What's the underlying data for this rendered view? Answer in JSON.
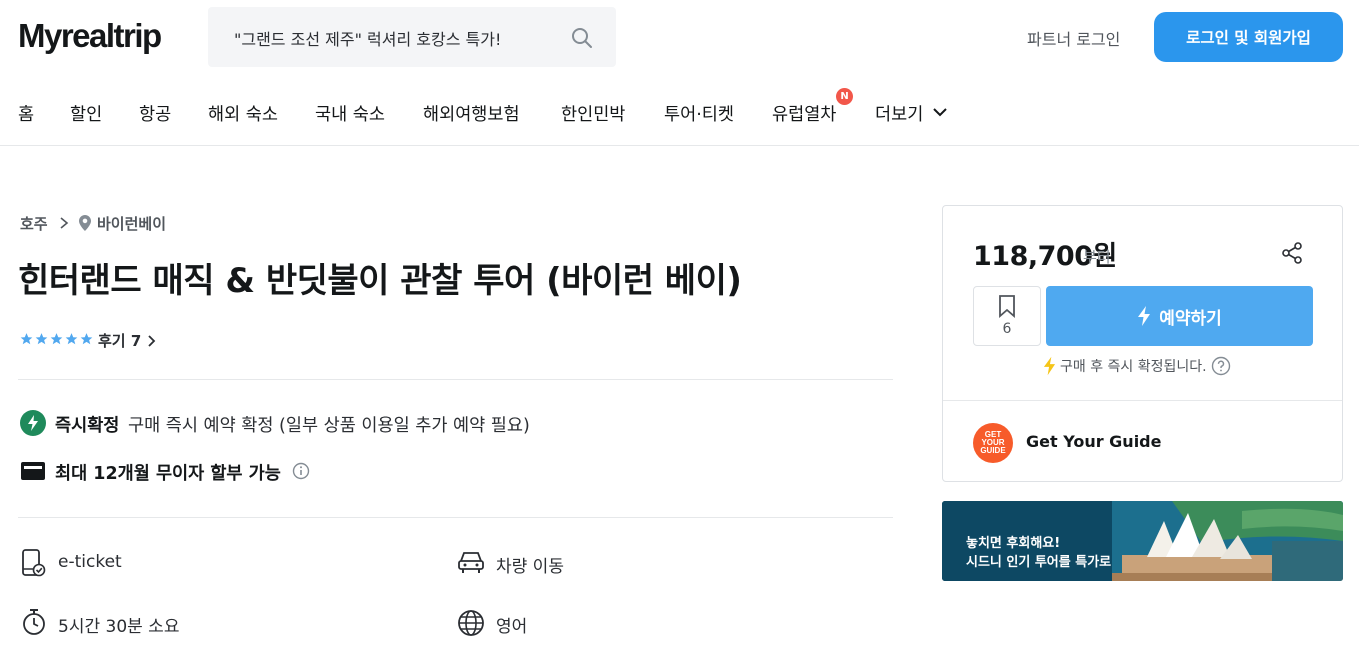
{
  "header": {
    "logo": "Myrealtrip",
    "search_placeholder": "\"그랜드 조선 제주\" 럭셔리 호캉스 특가!",
    "partner_login": "파트너 로그인",
    "login_signup": "로그인 및 회원가입"
  },
  "nav": {
    "items": [
      "홈",
      "할인",
      "항공",
      "해외 숙소",
      "국내 숙소",
      "해외여행보험",
      "한인민박",
      "투어·티켓",
      "유럽열차",
      "더보기"
    ],
    "new_badge": "N"
  },
  "product": {
    "breadcrumb_country": "호주",
    "breadcrumb_city": "바이런베이",
    "title": "힌터랜드 매직 & 반딧불이 관찰 투어 (바이런 베이)",
    "rating": 5,
    "review_label": "후기 7",
    "instant_strong": "즉시확정",
    "instant_text": "구매 즉시 예약 확정 (일부 상품 이용일 추가 예약 필요)",
    "installment": "최대 12개월 무이자 할부 가능",
    "features": {
      "ticket": "e-ticket",
      "transport": "차량 이동",
      "duration": "5시간 30분 소요",
      "language": "영어"
    }
  },
  "sidebar": {
    "price": "118,700원",
    "price_suffix": "부터",
    "wishlist_count": "6",
    "book_button": "예약하기",
    "confirm_text": "구매 후 즉시 확정됩니다.",
    "partner_name": "Get Your Guide",
    "partner_logo_text": "GET YOUR GUIDE"
  },
  "banner": {
    "line1": "놓치면 후회해요!",
    "line2": "시드니 인기 투어를 특가로"
  },
  "colors": {
    "brand_blue": "#2b96ed",
    "book_blue": "#4fa9f0",
    "instant_green": "#1f8a5b",
    "badge_red": "#f2574a",
    "gyg_orange": "#f75b2a"
  }
}
